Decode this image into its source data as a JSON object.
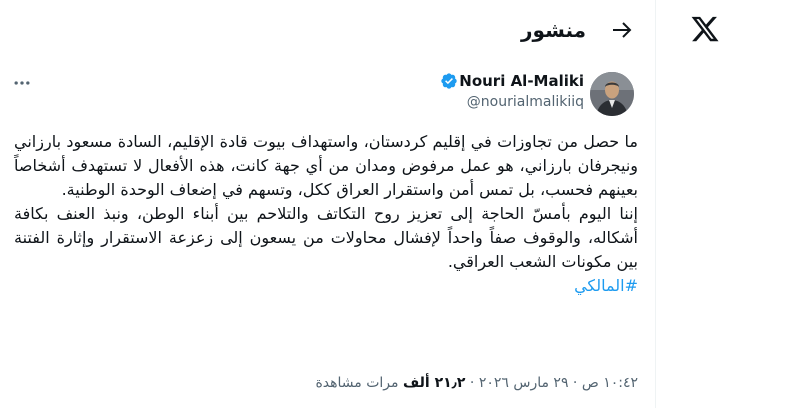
{
  "sidebar": {
    "logo_icon": "x-logo-icon"
  },
  "header": {
    "title": "منشور",
    "back_icon": "arrow-right-icon"
  },
  "post": {
    "author": {
      "display_name": "Nouri Al-Maliki",
      "handle": "@nourialmalikiiq",
      "verified": true,
      "verified_color": "#1d9bf0"
    },
    "paragraph_1": "ما حصل من تجاوزات في إقليم كردستان، واستهداف بيوت قادة الإقليم، السادة مسعود بارزاني ونيجرفان بارزاني، هو عمل مرفوض ومدان من أي جهة كانت، هذه الأفعال لا تستهدف أشخاصاً بعينهم فحسب، بل تمس أمن واستقرار العراق ككل، وتسهم في إضعاف الوحدة الوطنية.",
    "paragraph_2": "إننا اليوم بأمسّ الحاجة إلى تعزيز روح التكاتف والتلاحم بين أبناء الوطن، ونبذ العنف بكافة أشكاله، والوقوف صفاً واحداً لإفشال محاولات من يسعون إلى زعزعة الاستقرار وإثارة الفتنة بين مكونات الشعب العراقي.",
    "hashtag": "#المالكي",
    "timestamp": "١٠:٤٢ ص · ٢٩ مارس ٢٠٢٦",
    "views_count": "٢١٫٢ ألف",
    "views_label": "مرات مشاهدة",
    "link_color": "#1d9bf0"
  }
}
